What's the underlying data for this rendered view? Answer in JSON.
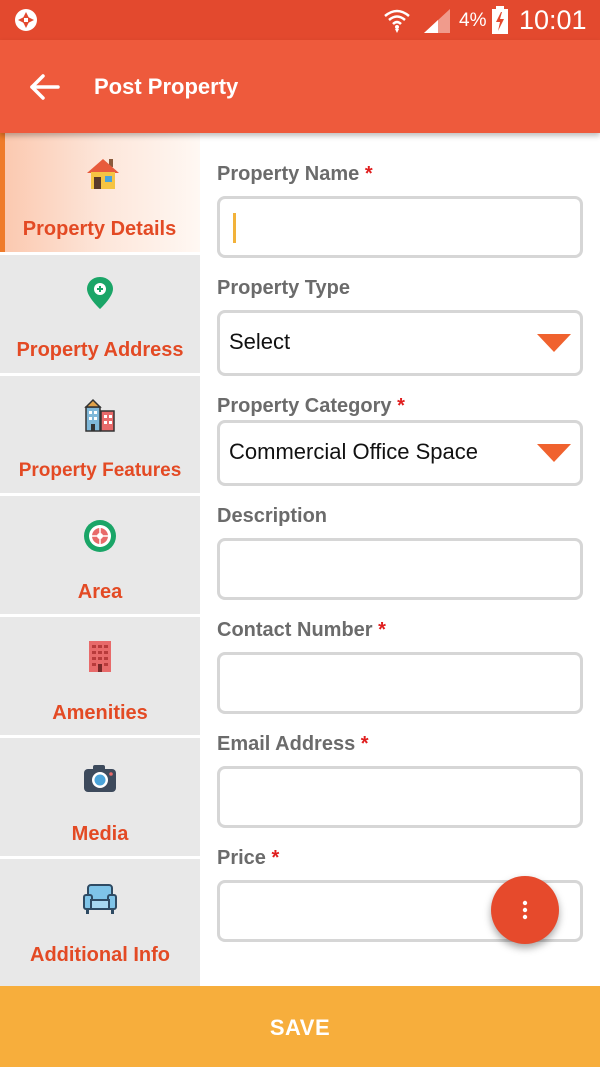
{
  "status_bar": {
    "battery_percent": "4%",
    "time": "10:01"
  },
  "app_bar": {
    "title": "Post Property"
  },
  "sidebar": {
    "items": [
      {
        "label": "Property Details",
        "icon": "house-icon",
        "active": true
      },
      {
        "label": "Property Address",
        "icon": "location-pin-icon",
        "active": false
      },
      {
        "label": "Property Features",
        "icon": "buildings-icon",
        "active": false
      },
      {
        "label": "Area",
        "icon": "target-icon",
        "active": false
      },
      {
        "label": "Amenities",
        "icon": "apartment-building-icon",
        "active": false
      },
      {
        "label": "Media",
        "icon": "camera-icon",
        "active": false
      },
      {
        "label": "Additional Info",
        "icon": "armchair-icon",
        "active": false
      }
    ]
  },
  "form": {
    "property_name": {
      "label": "Property Name",
      "required_mark": "*",
      "value": ""
    },
    "property_type": {
      "label": "Property Type",
      "value": "Select"
    },
    "property_category": {
      "label": "Property Category",
      "required_mark": "*",
      "value": "Commercial Office Space"
    },
    "description": {
      "label": "Description",
      "value": ""
    },
    "contact_number": {
      "label": "Contact Number",
      "required_mark": "*",
      "value": ""
    },
    "email_address": {
      "label": "Email Address",
      "required_mark": "*",
      "value": ""
    },
    "price": {
      "label": "Price",
      "required_mark": "*",
      "value": ""
    }
  },
  "footer": {
    "save_label": "SAVE"
  },
  "colors": {
    "status_bar": "#e3492e",
    "app_bar": "#ee5a3c",
    "accent_text": "#e34a24",
    "required": "#e01e1e",
    "save_bar": "#f7ae3c",
    "fab": "#e64a2c"
  }
}
